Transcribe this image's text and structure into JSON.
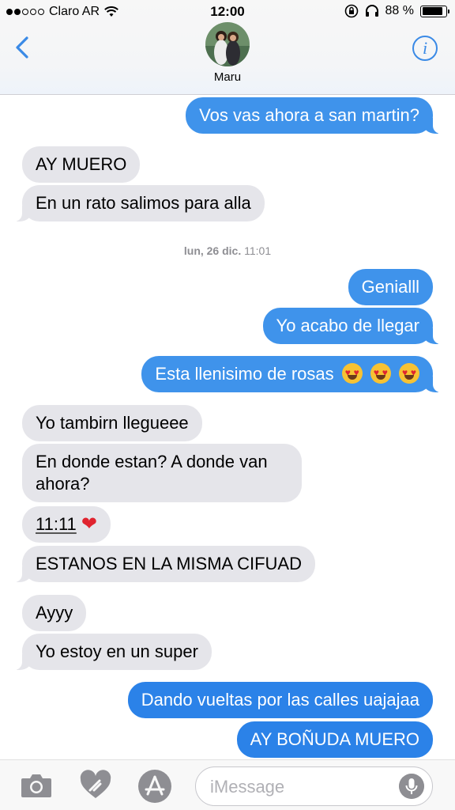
{
  "status_bar": {
    "carrier": "Claro AR",
    "time": "12:00",
    "battery_text": "88 %",
    "battery_level": 0.88,
    "signal_bars": 2
  },
  "header": {
    "contact_name": "Maru",
    "back_icon": "chevron-left-icon",
    "info_icon": "info-icon"
  },
  "messages": [
    {
      "from": "me",
      "text": "Vos vas ahora a san martin?"
    },
    {
      "from": "them",
      "text": "AY MUERO"
    },
    {
      "from": "them",
      "text": "En un rato salimos para alla"
    },
    {
      "from": "me",
      "text": "Genialll"
    },
    {
      "from": "me",
      "text": "Yo acabo de llegar"
    },
    {
      "from": "me",
      "text": "Esta llenisimo de rosas"
    },
    {
      "from": "them",
      "text": "Yo tambirn llegueee"
    },
    {
      "from": "them",
      "text": "En donde estan? A donde van ahora?"
    },
    {
      "from": "them",
      "text": "11:11"
    },
    {
      "from": "them",
      "text": "ESTANOS EN LA MISMA CIFUAD"
    },
    {
      "from": "them",
      "text": "Ayyy"
    },
    {
      "from": "them",
      "text": "Yo estoy en un super"
    },
    {
      "from": "me",
      "text": "Dando vueltas por las calles uajajaa"
    },
    {
      "from": "me",
      "text": "AY BOÑUDA MUERO"
    }
  ],
  "timestamp": {
    "day": "lun, 26 dic.",
    "time": "11:01"
  },
  "input": {
    "placeholder": "iMessage"
  },
  "colors": {
    "outgoing": "#3f93eb",
    "incoming": "#e5e5ea",
    "accent": "#3a8ae6"
  }
}
